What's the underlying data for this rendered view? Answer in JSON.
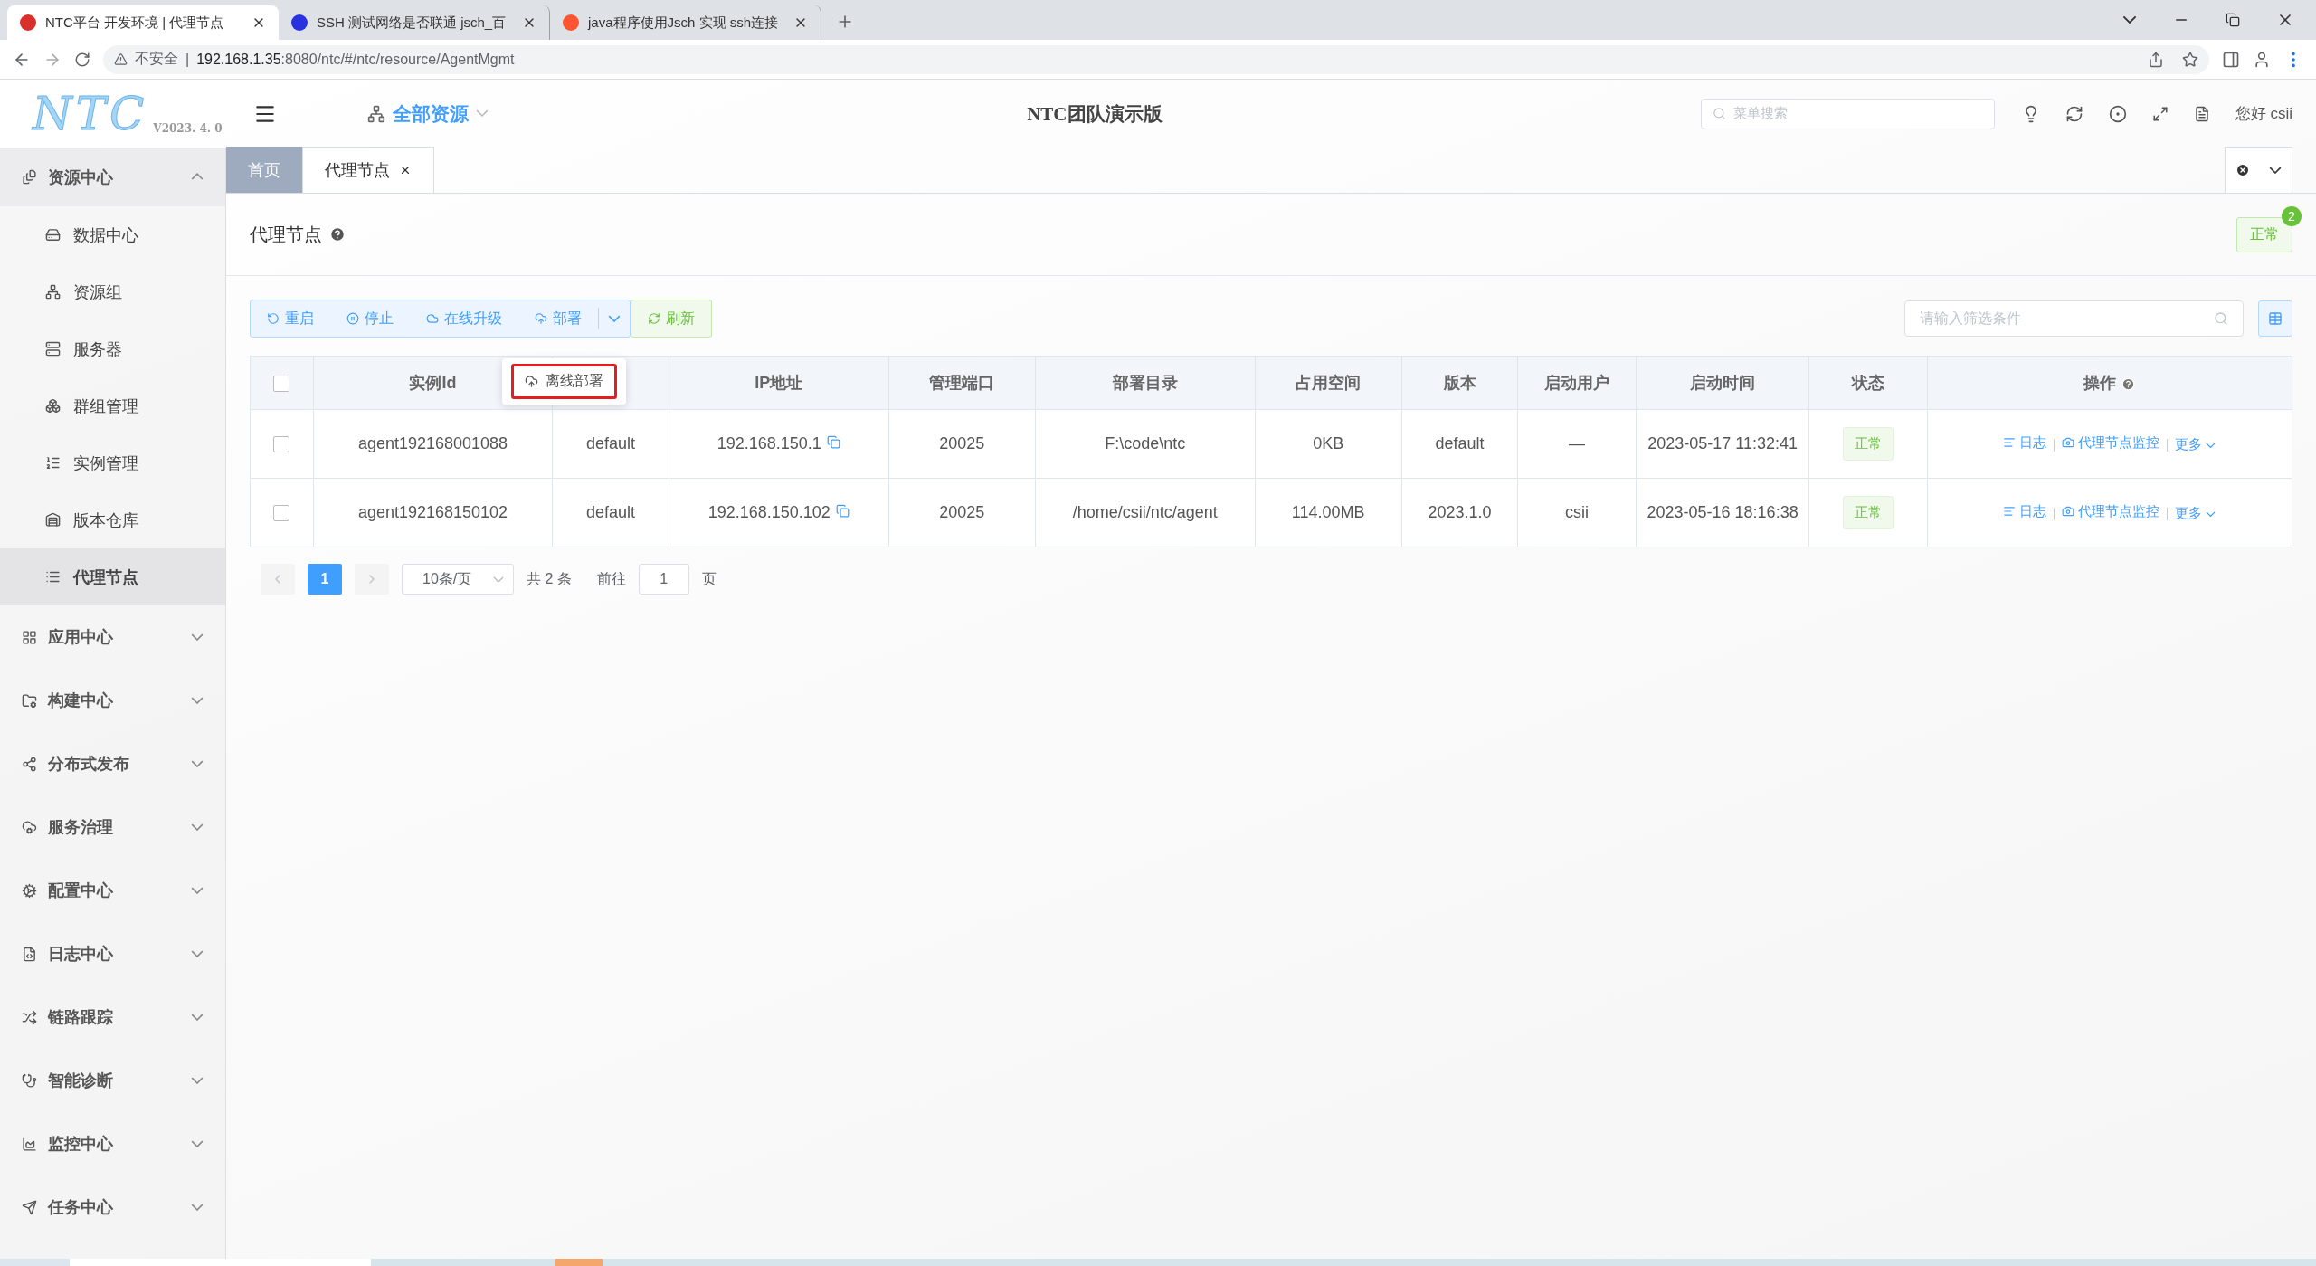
{
  "browser": {
    "tabs": [
      {
        "title": "NTC平台 开发环境 | 代理节点",
        "selected": true
      },
      {
        "title": "SSH 测试网络是否联通 jsch_百",
        "selected": false
      },
      {
        "title": "java程序使用Jsch 实现 ssh连接",
        "selected": false
      }
    ],
    "address": {
      "warning": "不安全",
      "separator": "|",
      "host": "192.168.1.35",
      "path": ":8080/ntc/#/ntc/resource/AgentMgmt"
    }
  },
  "header": {
    "logo": "NTC",
    "version": "V2023. 4. 0",
    "resource_selector": "全部资源",
    "title": "NTC团队演示版",
    "search": {
      "placeholder": "菜单搜索"
    },
    "user": "您好 csii"
  },
  "sidebar": {
    "groups": [
      {
        "label": "资源中心",
        "expanded": true,
        "children": [
          {
            "label": "数据中心",
            "selected": false
          },
          {
            "label": "资源组",
            "selected": false
          },
          {
            "label": "服务器",
            "selected": false
          },
          {
            "label": "群组管理",
            "selected": false
          },
          {
            "label": "实例管理",
            "selected": false
          },
          {
            "label": "版本仓库",
            "selected": false
          },
          {
            "label": "代理节点",
            "selected": true
          }
        ]
      },
      {
        "label": "应用中心",
        "expanded": false
      },
      {
        "label": "构建中心",
        "expanded": false
      },
      {
        "label": "分布式发布",
        "expanded": false
      },
      {
        "label": "服务治理",
        "expanded": false
      },
      {
        "label": "配置中心",
        "expanded": false
      },
      {
        "label": "日志中心",
        "expanded": false
      },
      {
        "label": "链路跟踪",
        "expanded": false
      },
      {
        "label": "智能诊断",
        "expanded": false
      },
      {
        "label": "监控中心",
        "expanded": false
      },
      {
        "label": "任务中心",
        "expanded": false
      }
    ]
  },
  "page_tabs": [
    {
      "label": "首页",
      "selected": false,
      "closable": false
    },
    {
      "label": "代理节点",
      "selected": true,
      "closable": true
    }
  ],
  "page": {
    "title": "代理节点",
    "status": "正常",
    "status_count": "2"
  },
  "toolbar": {
    "buttons": [
      {
        "label": "重启",
        "kind": "grouped"
      },
      {
        "label": "停止",
        "kind": "grouped"
      },
      {
        "label": "在线升级",
        "kind": "grouped"
      },
      {
        "label": "部署",
        "kind": "split"
      },
      {
        "label": "刷新",
        "kind": "success"
      }
    ],
    "dropdown": [
      {
        "label": "离线部署",
        "highlighted": true
      }
    ],
    "filter": {
      "placeholder": "请输入筛选条件"
    }
  },
  "table": {
    "header_checked": false,
    "columns": [
      "实例Id",
      "",
      "IP地址",
      "管理端口",
      "部署目录",
      "占用空间",
      "版本",
      "启动用户",
      "启动时间",
      "状态",
      "操作"
    ],
    "rows": [
      {
        "checked": false,
        "id": "agent192168001088",
        "column_2": "default",
        "ip": "192.168.150.1",
        "port": "20025",
        "dir": "F:\\code\\ntc",
        "space": "0KB",
        "version": "default",
        "user": "—",
        "time": "2023-05-17 11:32:41",
        "status": "正常",
        "actions": [
          "日志",
          "代理节点监控",
          "更多"
        ]
      },
      {
        "checked": false,
        "id": "agent192168150102",
        "column_2": "default",
        "ip": "192.168.150.102",
        "port": "20025",
        "dir": "/home/csii/ntc/agent",
        "space": "114.00MB",
        "version": "2023.1.0",
        "user": "csii",
        "time": "2023-05-16 18:16:38",
        "status": "正常",
        "actions": [
          "日志",
          "代理节点监控",
          "更多"
        ]
      }
    ]
  },
  "pagination": {
    "pages": [
      {
        "label": "1",
        "selected": true
      }
    ],
    "page_size": "10条/页",
    "total": "共 2 条",
    "goto_label": "前往",
    "goto_value": "1",
    "goto_suffix": "页"
  }
}
